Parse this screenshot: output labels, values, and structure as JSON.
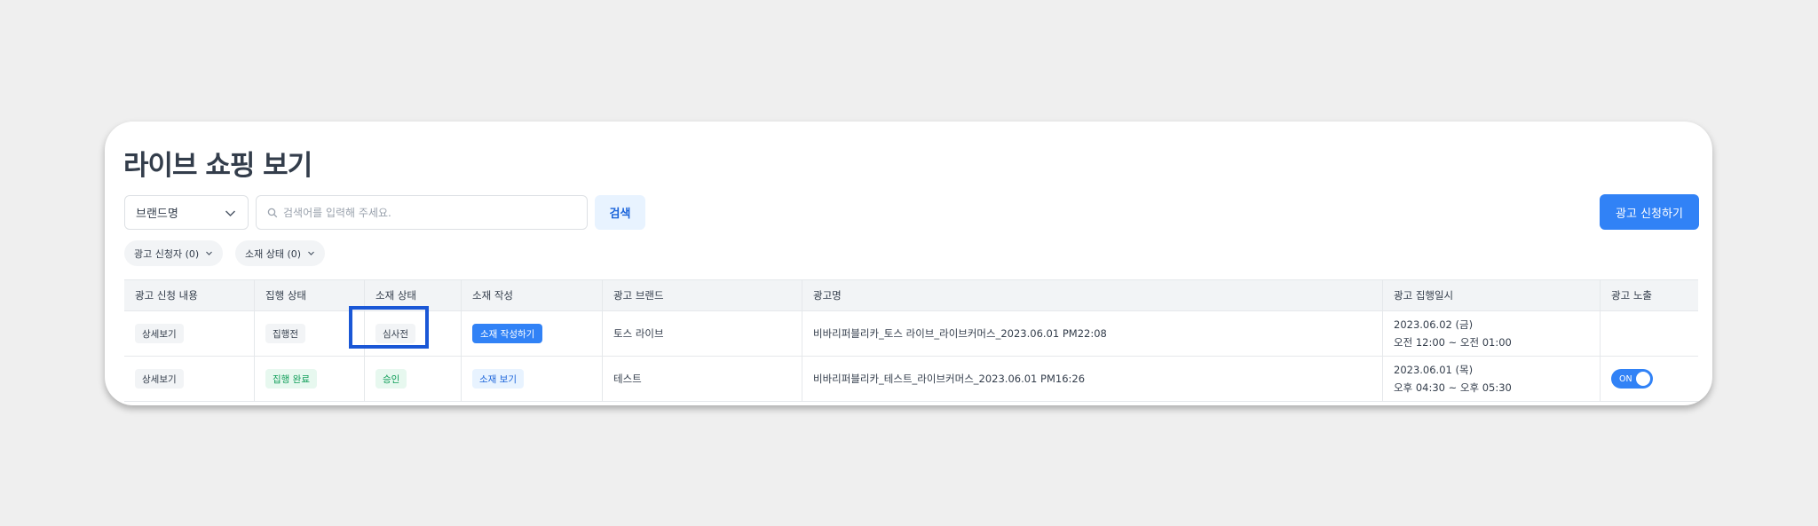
{
  "page": {
    "title": "라이브 쇼핑 보기"
  },
  "filters": {
    "brand_select": "브랜드명",
    "search_placeholder": "검색어를 입력해 주세요.",
    "search_button": "검색",
    "apply_button": "광고 신청하기",
    "chips": [
      "광고 신청자 (0)",
      "소재 상태 (0)"
    ]
  },
  "table": {
    "headers": [
      "광고 신청 내용",
      "집행 상태",
      "소재 상태",
      "소재 작성",
      "광고 브랜드",
      "광고명",
      "광고 집행일시",
      "광고 노출"
    ],
    "rows": [
      {
        "detail": "상세보기",
        "exec_status": "집행전",
        "material_status": "심사전",
        "material_action": "소재 작성하기",
        "brand": "토스 라이브",
        "ad_name": "비바리퍼블리카_토스 라이브_라이브커머스_2023.06.01 PM22:08",
        "date_line1": "2023.06.02 (금)",
        "date_line2": "오전 12:00 ~ 오전 01:00",
        "exposure": ""
      },
      {
        "detail": "상세보기",
        "exec_status": "집행 완료",
        "material_status": "승인",
        "material_action": "소재 보기",
        "brand": "테스트",
        "ad_name": "비바리퍼블리카_테스트_라이브커머스_2023.06.01 PM16:26",
        "date_line1": "2023.06.01 (목)",
        "date_line2": "오후 04:30 ~ 오후 05:30",
        "exposure": "ON"
      }
    ]
  },
  "colors": {
    "accent": "#3182f6",
    "highlight": "#1a57d6",
    "success": "#0f9d58"
  },
  "icons": {
    "search": "search-icon",
    "chevron": "chevron-down-icon"
  }
}
